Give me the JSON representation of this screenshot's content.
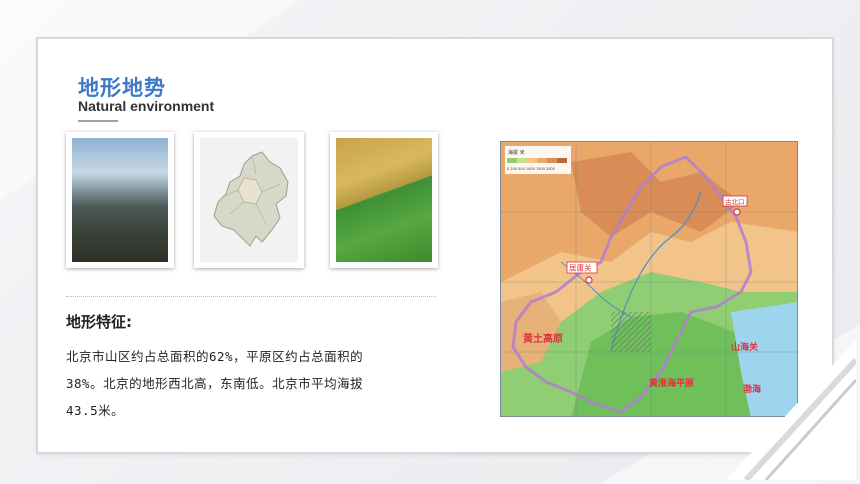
{
  "header": {
    "title": "地形地势",
    "subtitle": "Natural environment"
  },
  "photos": [
    {
      "name": "mountain-photo"
    },
    {
      "name": "beijing-outline-map"
    },
    {
      "name": "farmland-aerial-photo"
    }
  ],
  "features": {
    "heading": "地形特征:",
    "line1": "北京市山区约占总面积的62%，平原区约占总面积的",
    "line2": "38%。北京的地形西北高，东南低。北京市平均海拔",
    "line3": "43.5米。"
  },
  "map": {
    "legend_title": "海拔 米",
    "legend_ticks": "0  200 500 1000 1500 2000",
    "labels": {
      "loess": "黄土高原",
      "plain": "黄淮海平原",
      "shanhaiguan": "山海关",
      "bohai": "渤海",
      "juyongguan": "居庸关",
      "gubeikou": "古北口"
    }
  },
  "colors": {
    "title_blue": "#3e78c7",
    "boundary_purple": "#b27fcf",
    "label_red": "#e0313a"
  }
}
